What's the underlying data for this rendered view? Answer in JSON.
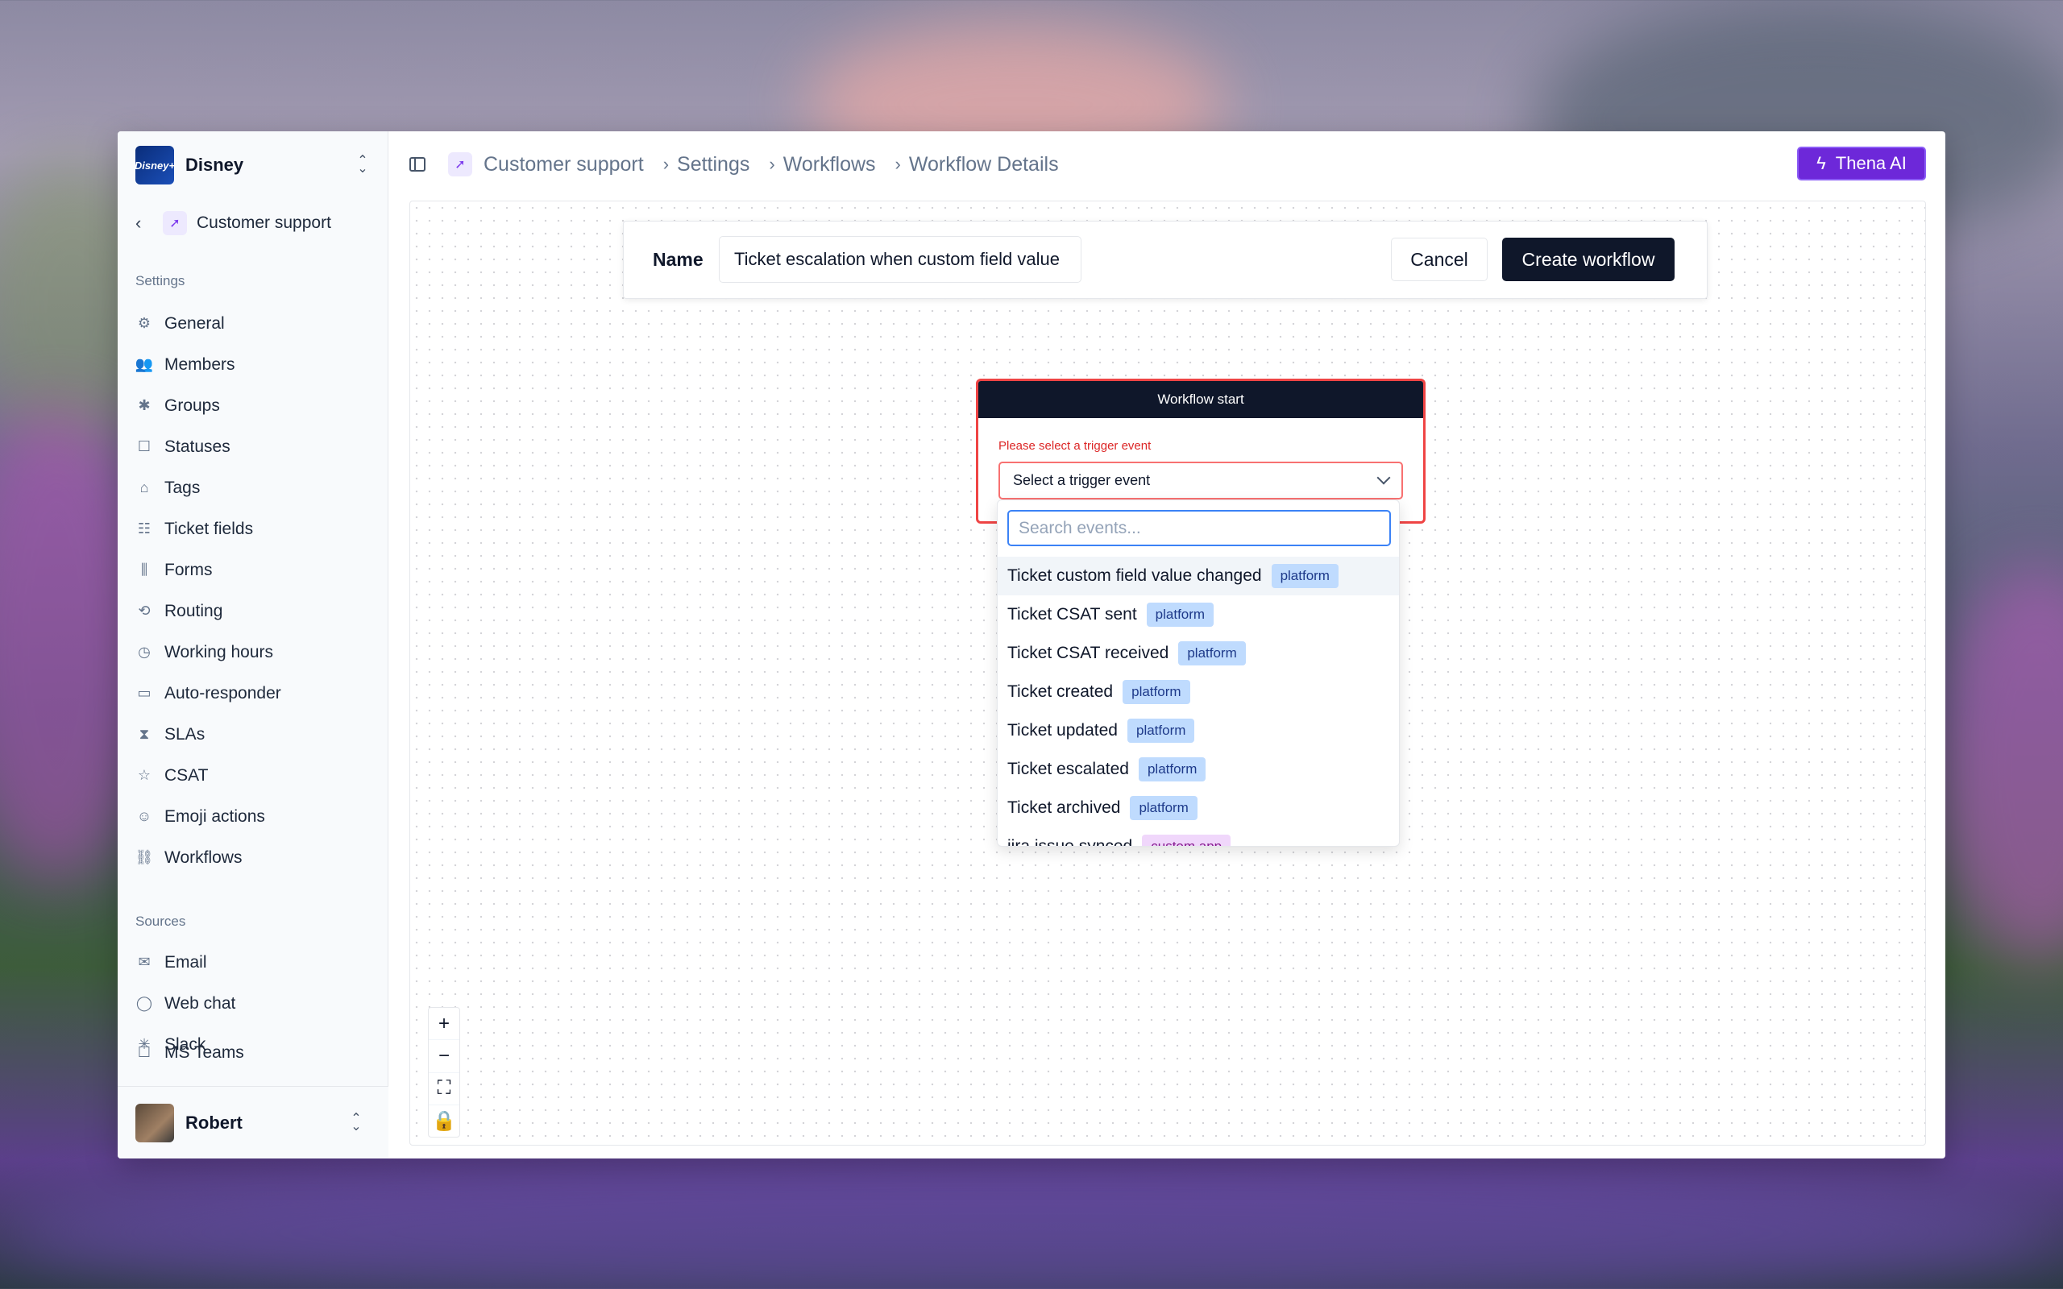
{
  "org": {
    "name": "Disney",
    "logo_text": "Disney+"
  },
  "back": {
    "label": "Customer support"
  },
  "settings": {
    "title": "Settings",
    "items": [
      {
        "label": "General",
        "icon": "gear-icon"
      },
      {
        "label": "Members",
        "icon": "users-icon"
      },
      {
        "label": "Groups",
        "icon": "person-icon"
      },
      {
        "label": "Statuses",
        "icon": "square-icon"
      },
      {
        "label": "Tags",
        "icon": "tag-icon"
      },
      {
        "label": "Ticket fields",
        "icon": "fields-icon"
      },
      {
        "label": "Forms",
        "icon": "library-icon"
      },
      {
        "label": "Routing",
        "icon": "routing-icon"
      },
      {
        "label": "Working hours",
        "icon": "clock-icon"
      },
      {
        "label": "Auto-responder",
        "icon": "message-icon"
      },
      {
        "label": "SLAs",
        "icon": "hourglass-icon"
      },
      {
        "label": "CSAT",
        "icon": "star-icon"
      },
      {
        "label": "Emoji actions",
        "icon": "smile-icon"
      },
      {
        "label": "Workflows",
        "icon": "workflow-icon"
      }
    ]
  },
  "sources": {
    "title": "Sources",
    "items": [
      {
        "label": "Email",
        "icon": "mail-icon"
      },
      {
        "label": "Web chat",
        "icon": "chat-icon"
      },
      {
        "label": "Slack",
        "icon": "slack-icon"
      },
      {
        "label": "MS Teams",
        "icon": "teams-icon"
      }
    ]
  },
  "user": {
    "name": "Robert"
  },
  "breadcrumb": [
    "Customer support",
    "Settings",
    "Workflows",
    "Workflow Details"
  ],
  "thena": {
    "label": "Thena AI"
  },
  "form": {
    "name_label": "Name",
    "name_value": "Ticket escalation when custom field value",
    "cancel_label": "Cancel",
    "create_label": "Create workflow"
  },
  "node": {
    "title": "Workflow start",
    "hint": "Please select a trigger event",
    "select_placeholder": "Select a trigger event"
  },
  "dropdown": {
    "search_placeholder": "Search events...",
    "items": [
      {
        "label": "Ticket custom field value changed",
        "tag": "platform"
      },
      {
        "label": "Ticket CSAT sent",
        "tag": "platform"
      },
      {
        "label": "Ticket CSAT received",
        "tag": "platform"
      },
      {
        "label": "Ticket created",
        "tag": "platform"
      },
      {
        "label": "Ticket updated",
        "tag": "platform"
      },
      {
        "label": "Ticket escalated",
        "tag": "platform"
      },
      {
        "label": "Ticket archived",
        "tag": "platform"
      },
      {
        "label": "jira issue synced",
        "tag": "custom app"
      }
    ]
  },
  "colors": {
    "accent": "#6d28d9",
    "error": "#ef4444",
    "primary": "#0f172a",
    "tag_platform": "#bfdbfe",
    "tag_custom": "#f0d7fb"
  }
}
